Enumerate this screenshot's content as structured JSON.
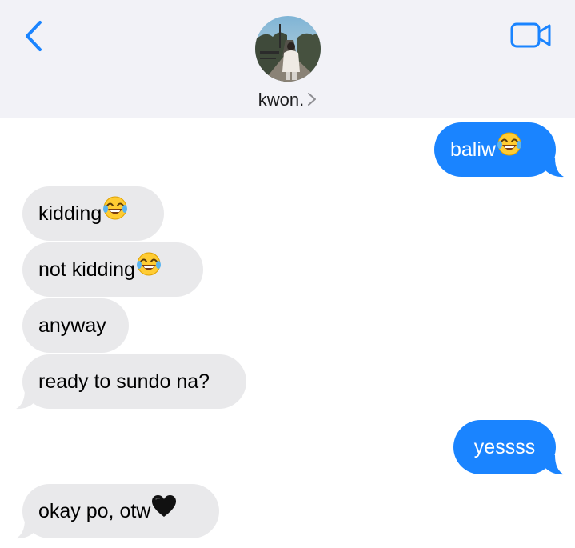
{
  "header": {
    "contact_name": "kwon.",
    "accent_color": "#1a84ff",
    "icons": {
      "back": "chevron-left-icon",
      "video": "video-camera-icon",
      "name_chevron": "chevron-right-icon"
    }
  },
  "messages": [
    {
      "direction": "outgoing",
      "text": "baliw",
      "emoji": "face-with-tears-of-joy"
    },
    {
      "direction": "incoming",
      "text": "kidding",
      "emoji": "face-with-tears-of-joy"
    },
    {
      "direction": "incoming",
      "text": "not kidding",
      "emoji": "face-with-tears-of-joy"
    },
    {
      "direction": "incoming",
      "text": "anyway",
      "emoji": ""
    },
    {
      "direction": "incoming",
      "text": "ready to sundo na?",
      "emoji": ""
    },
    {
      "direction": "outgoing",
      "text": "yessss",
      "emoji": ""
    },
    {
      "direction": "incoming",
      "text": "okay po, otw",
      "emoji": "black-heart"
    }
  ],
  "colors": {
    "incoming_bubble": "#e9e9eb",
    "outgoing_bubble": "#1a84ff",
    "header_background": "#f2f2f7"
  }
}
